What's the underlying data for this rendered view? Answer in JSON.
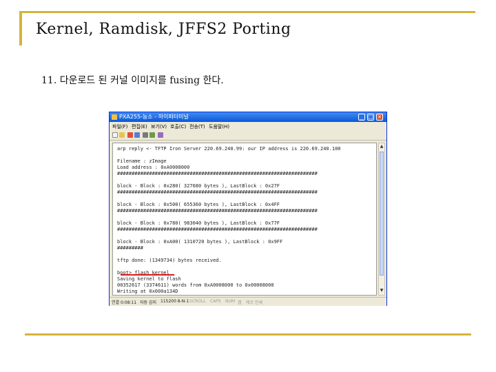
{
  "slide": {
    "title": "Kernel, Ramdisk, JFFS2 Porting",
    "subtitle": "11. 다운로드 된 커널 이미지를 fusing 한다."
  },
  "window": {
    "title": "PXA255-농소 - 하이퍼터미널",
    "menu": [
      "파일(F)",
      "편집(E)",
      "보기(V)",
      "호출(C)",
      "전송(T)",
      "도움말(H)"
    ],
    "terminal_lines": [
      "arp reply <- TFTP Iron Server 220.69.240.99: our IP address is 220.69.240.100",
      "Filename       : zImage",
      "Load address   : 0xA0008000",
      "#####################################################################",
      "block - Block : 0x280( 327680 bytes ), LastBlock : 0x27F",
      "#####################################################################",
      "block - Block : 0x500( 655360 bytes ), LastBlock : 0x4FF",
      "#####################################################################",
      "block - Block : 0x780( 983040 bytes ), LastBlock : 0x77F",
      "#####################################################################",
      "block - Block : 0xA00( 1310720 bytes ), LastBlock : 0x9FF",
      "#########",
      "tftp done: (1349734) bytes received.",
      "boot> flash kernel",
      "Saving kernel to flash",
      "00352617 (3374611) words from 0xA0008000 to 0x00008000",
      "Writing at 0x000a134D"
    ],
    "status": {
      "time": "연결 0:08:11",
      "detect": "자동 감지",
      "baud": "115200 8-N-1",
      "scroll": "SCROLL",
      "caps": "CAPS",
      "num": "NUM",
      "capture": "캡",
      "echo": "에코 인쇄"
    }
  },
  "colors": {
    "frame_accent": "#d4b43a",
    "title_bar": "#0a57d8",
    "marker": "#e01818"
  },
  "icons": [
    "minimize-icon",
    "maximize-icon",
    "close-icon"
  ]
}
